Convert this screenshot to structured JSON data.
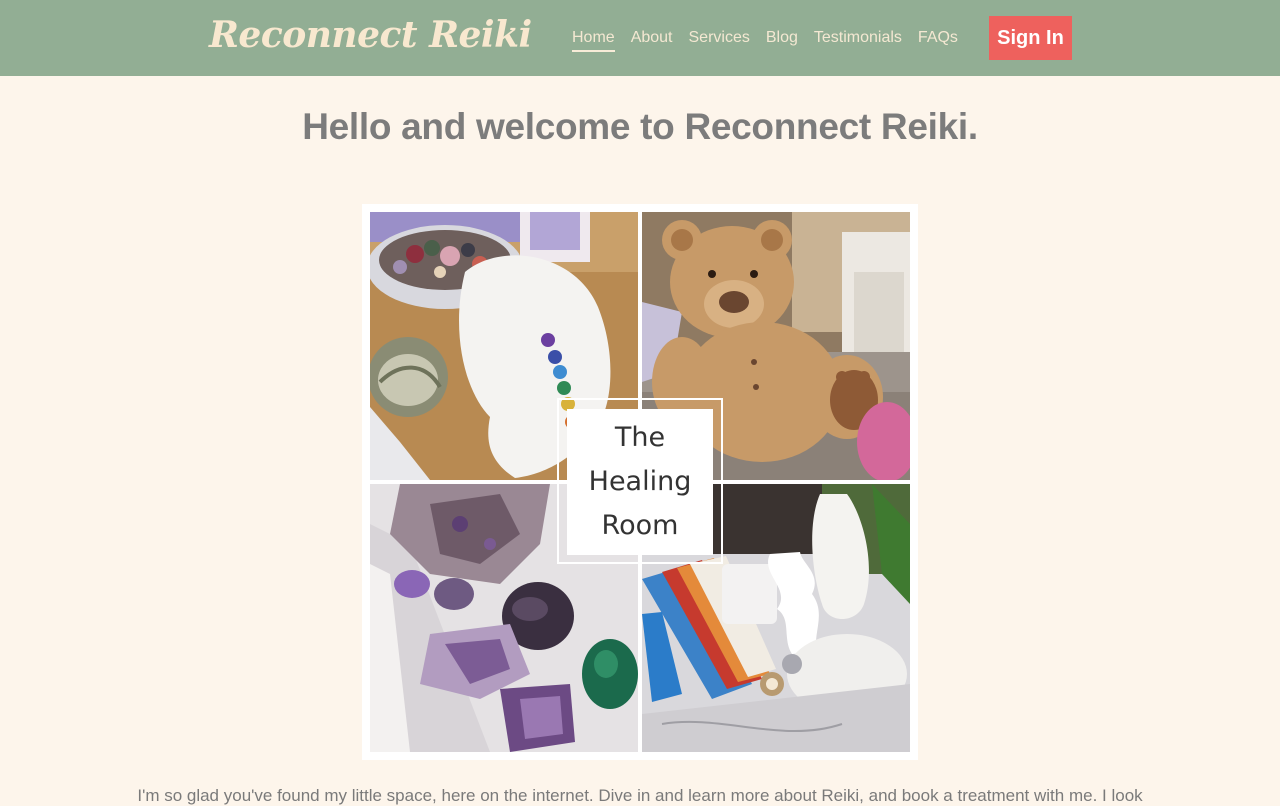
{
  "header": {
    "logo": "Reconnect Reiki",
    "nav": [
      {
        "label": "Home",
        "active": true
      },
      {
        "label": "About"
      },
      {
        "label": "Services"
      },
      {
        "label": "Blog"
      },
      {
        "label": "Testimonials"
      },
      {
        "label": "FAQs"
      }
    ],
    "signin_label": "Sign In"
  },
  "main": {
    "headline": "Hello and welcome to Reconnect Reiki.",
    "collage": {
      "caption_lines": [
        "The",
        "Healing",
        "Room"
      ]
    },
    "intro": "I'm so glad you've found my little space, here on the internet. Dive in and learn more about Reiki, and book a treatment with me. I look"
  },
  "colors": {
    "nav_bg": "#92ae94",
    "page_bg": "#fdf5eb",
    "signin_bg": "#ee615d",
    "logo_text": "#f8e8cf",
    "headline_text": "#7c7c7c"
  }
}
